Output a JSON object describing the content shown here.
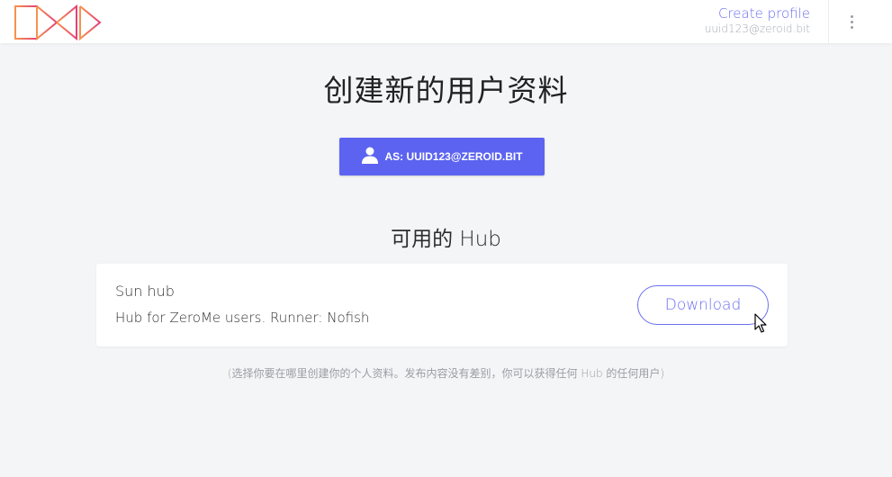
{
  "header": {
    "logo_icon": "zeronet-logo-icon",
    "create_profile_label": "Create profile",
    "user_address": "uuid123@zeroid.bit",
    "menu_icon": "more-vertical-icon"
  },
  "main": {
    "title": "创建新的用户资料",
    "as_button": {
      "icon": "user-icon",
      "label": "AS: UUID123@ZEROID.BIT"
    },
    "hubs_heading": "可用的 Hub",
    "hubs": [
      {
        "name": "Sun hub",
        "description": "Hub for ZeroMe users. Runner: Nofish",
        "download_label": "Download"
      }
    ],
    "footnote": "(选择你要在哪里创建你的个人资料。发布内容没有差别，你可以获得任何 Hub 的任何用户)"
  },
  "colors": {
    "accent": "#5c63f0",
    "link": "#6a6ff0",
    "background": "#f4f5f7",
    "logo_gradient_start": "#f7934b",
    "logo_gradient_end": "#e3417a"
  }
}
